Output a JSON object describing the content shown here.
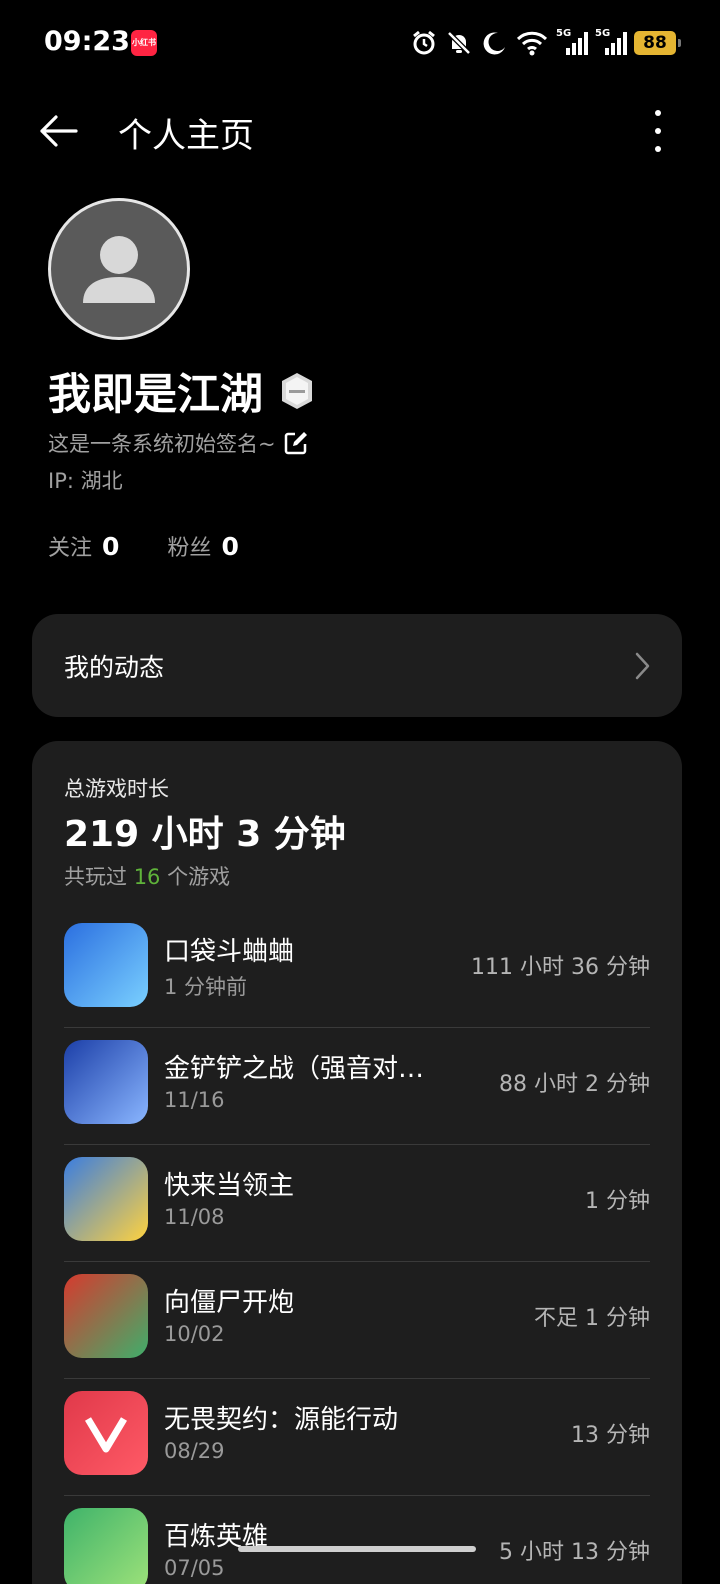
{
  "status_bar": {
    "time": "09:23",
    "app_badge": "小红书",
    "signal_1": "5G",
    "signal_2": "5G",
    "battery": "88",
    "icons": [
      "alarm-icon",
      "bell-muted-icon",
      "moon-icon",
      "wifi-icon",
      "signal-icon",
      "signal-icon",
      "battery-icon"
    ]
  },
  "header": {
    "title": "个人主页",
    "back_icon": "arrow-left-icon",
    "more_icon": "more-vertical-icon"
  },
  "profile": {
    "username": "我即是江湖",
    "signature": "这是一条系统初始签名~",
    "ip": "IP: 湖北",
    "following_label": "关注",
    "following_count": "0",
    "followers_label": "粉丝",
    "followers_count": "0"
  },
  "feed": {
    "label": "我的动态"
  },
  "playtime": {
    "title": "总游戏时长",
    "total": "219 小时 3 分钟",
    "count_prefix": "共玩过",
    "count": "16",
    "count_suffix": "个游戏",
    "games": [
      {
        "name": "口袋斗蛐蛐",
        "date": "1 分钟前",
        "time": "111 小时 36 分钟",
        "colors": [
          "#2b6fe0",
          "#7ad0ff"
        ]
      },
      {
        "name": "金铲铲之战（强音对…",
        "date": "11/16",
        "time": "88 小时 2 分钟",
        "colors": [
          "#1c3fa8",
          "#8ab6ff"
        ]
      },
      {
        "name": "快来当领主",
        "date": "11/08",
        "time": "1 分钟",
        "colors": [
          "#3a7de0",
          "#ffd23f"
        ]
      },
      {
        "name": "向僵尸开炮",
        "date": "10/02",
        "time": "不足 1 分钟",
        "colors": [
          "#d63a2e",
          "#3fae6b"
        ]
      },
      {
        "name": "无畏契约：源能行动",
        "date": "08/29",
        "time": "13 分钟",
        "colors": [
          "#e0394a",
          "#ff5a66"
        ]
      },
      {
        "name": "百炼英雄",
        "date": "07/05",
        "time": "5 小时 13 分钟",
        "colors": [
          "#3fb36a",
          "#9ee27a"
        ]
      }
    ]
  }
}
